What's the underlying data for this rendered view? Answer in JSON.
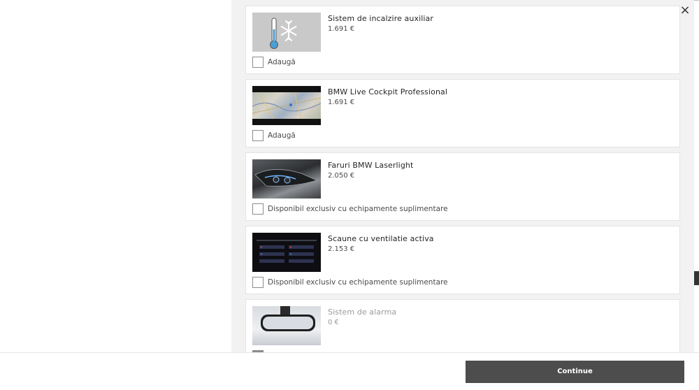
{
  "close_label": "×",
  "options": [
    {
      "title": "Sistem de incalzire auxiliar",
      "price": "1.691 €",
      "check_label": "Adaugă",
      "image": "heater-thermometer-snowflake"
    },
    {
      "title": "BMW Live Cockpit Professional",
      "price": "1.691 €",
      "check_label": "Adaugă",
      "image": "navigation-map-display"
    },
    {
      "title": "Faruri BMW Laserlight",
      "price": "2.050 €",
      "check_label": "Disponibil exclusiv cu echipamente suplimentare",
      "image": "laserlight-headlamp"
    },
    {
      "title": "Scaune cu ventilatie activa",
      "price": "2.153 €",
      "check_label": "Disponibil exclusiv cu echipamente suplimentare",
      "image": "seat-ventilation-screen"
    },
    {
      "title": "Sistem de alarma",
      "price": "0 €",
      "check_label": "",
      "image": "rearview-mirror"
    }
  ],
  "footer": {
    "continue_label": "Continue"
  },
  "colors": {
    "button": "#4d4d4d",
    "panel_bg": "#f2f2f2"
  }
}
